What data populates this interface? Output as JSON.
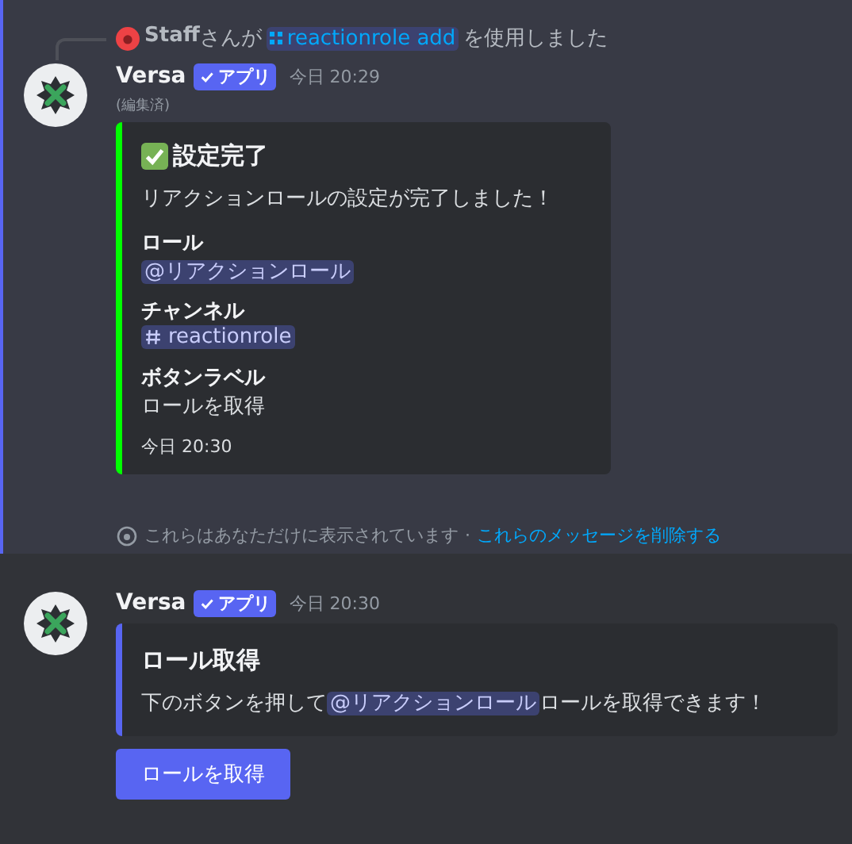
{
  "ephemeral_message": {
    "highlighted": true,
    "reply": {
      "user": "Staff",
      "text_before": "さんが",
      "command": "reactionrole add",
      "text_after": "を使用しました"
    },
    "author": "Versa",
    "badge": "アプリ",
    "timestamp": "今日 20:29",
    "edited": "(編集済)",
    "embed": {
      "color": "#00ff00",
      "title": "設定完了",
      "description": "リアクションロールの設定が完了しました！",
      "fields": [
        {
          "name": "ロール",
          "value": "@リアクションロール",
          "kind": "mention"
        },
        {
          "name": "チャンネル",
          "value": "reactionrole",
          "kind": "channel"
        },
        {
          "name": "ボタンラベル",
          "value": "ロールを取得",
          "kind": "text"
        }
      ],
      "footer": "今日 20:30"
    },
    "notice": {
      "text": "これらはあなただけに表示されています",
      "separator": "·",
      "link": "これらのメッセージを削除する"
    }
  },
  "message": {
    "author": "Versa",
    "badge": "アプリ",
    "timestamp": "今日 20:30",
    "embed": {
      "color": "#5865f2",
      "title": "ロール取得",
      "description_before": "下のボタンを押して",
      "mention": "@リアクションロール",
      "description_after": "ロールを取得できます！"
    },
    "button": "ロールを取得"
  }
}
